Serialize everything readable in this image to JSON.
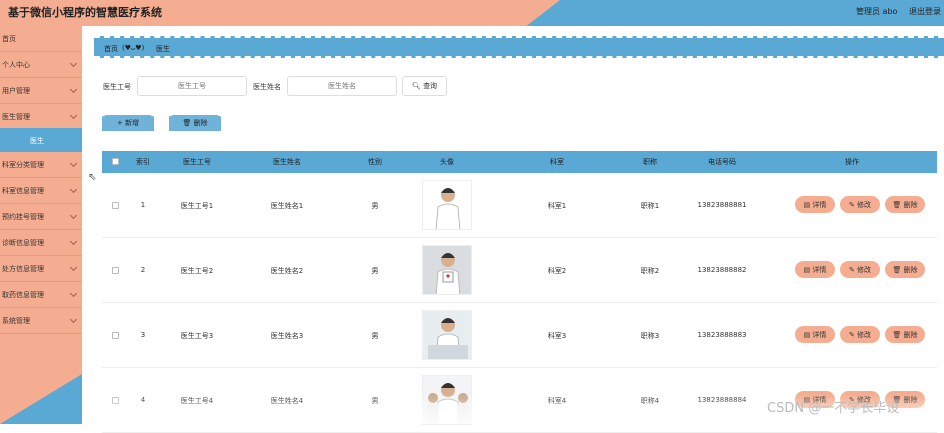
{
  "header": {
    "title": "基于微信小程序的智慧医疗系统",
    "admin": "管理员 abo",
    "logout": "退出登录"
  },
  "sidebar": {
    "items": [
      {
        "label": "首页",
        "chevron": false
      },
      {
        "label": "个人中心",
        "chevron": true
      },
      {
        "label": "用户管理",
        "chevron": true
      },
      {
        "label": "医生管理",
        "chevron": true
      },
      {
        "label": "科室分类管理",
        "chevron": true
      },
      {
        "label": "科室信息管理",
        "chevron": true
      },
      {
        "label": "预约挂号管理",
        "chevron": true
      },
      {
        "label": "诊断信息管理",
        "chevron": true
      },
      {
        "label": "处方信息管理",
        "chevron": true
      },
      {
        "label": "取药信息管理",
        "chevron": true
      },
      {
        "label": "系统管理",
        "chevron": true
      }
    ],
    "sub_item": "医生"
  },
  "breadcrumb": {
    "home": "首页",
    "sep": "(♥ᴗ♥)",
    "current": "医生"
  },
  "search": {
    "id_label": "医生工号",
    "id_placeholder": "医生工号",
    "name_label": "医生姓名",
    "name_placeholder": "医生姓名",
    "query_label": "查询"
  },
  "actions": {
    "add": "新增",
    "delete": "删除"
  },
  "table": {
    "headers": [
      "索引",
      "医生工号",
      "医生姓名",
      "性别",
      "头像",
      "科室",
      "职称",
      "电话号码",
      "操作"
    ],
    "rows": [
      {
        "index": "1",
        "id": "医生工号1",
        "name": "医生姓名1",
        "gender": "男",
        "dept": "科室1",
        "title": "职称1",
        "phone": "13823888881"
      },
      {
        "index": "2",
        "id": "医生工号2",
        "name": "医生姓名2",
        "gender": "男",
        "dept": "科室2",
        "title": "职称2",
        "phone": "13823888882"
      },
      {
        "index": "3",
        "id": "医生工号3",
        "name": "医生姓名3",
        "gender": "男",
        "dept": "科室3",
        "title": "职称3",
        "phone": "13823888883"
      },
      {
        "index": "4",
        "id": "医生工号4",
        "name": "医生姓名4",
        "gender": "男",
        "dept": "科室4",
        "title": "职称4",
        "phone": "13823888884"
      }
    ],
    "row_actions": {
      "detail": "详情",
      "edit": "修改",
      "delete": "删除"
    }
  },
  "watermark": "CSDN @一不学长毕设",
  "colors": {
    "salmon": "#f4ad90",
    "blue": "#5aa8d4"
  }
}
